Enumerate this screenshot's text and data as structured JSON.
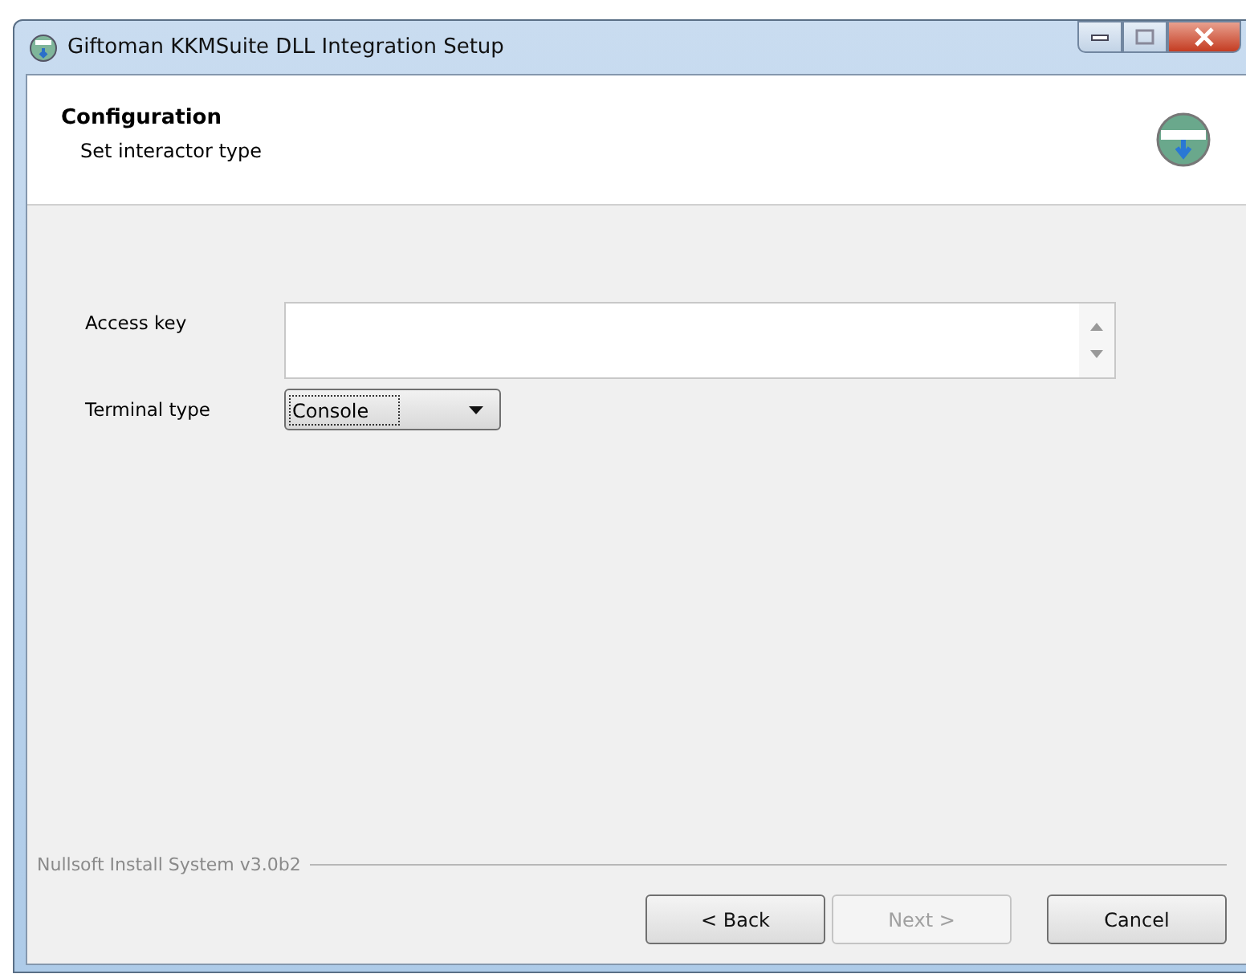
{
  "window": {
    "title": "Giftoman KKMSuite DLL Integration Setup"
  },
  "header": {
    "title": "Configuration",
    "subtitle": "Set interactor type"
  },
  "fields": [
    {
      "kind": "textarea",
      "label": "Access key"
    },
    {
      "kind": "dropdown",
      "label": "Terminal type",
      "value": "Console"
    }
  ],
  "branding": "Nullsoft Install System v3.0b2",
  "buttons": [
    {
      "label": "< Back",
      "disabled": false
    },
    {
      "label": "Next >",
      "disabled": true
    },
    {
      "label": "Cancel",
      "disabled": false
    }
  ]
}
